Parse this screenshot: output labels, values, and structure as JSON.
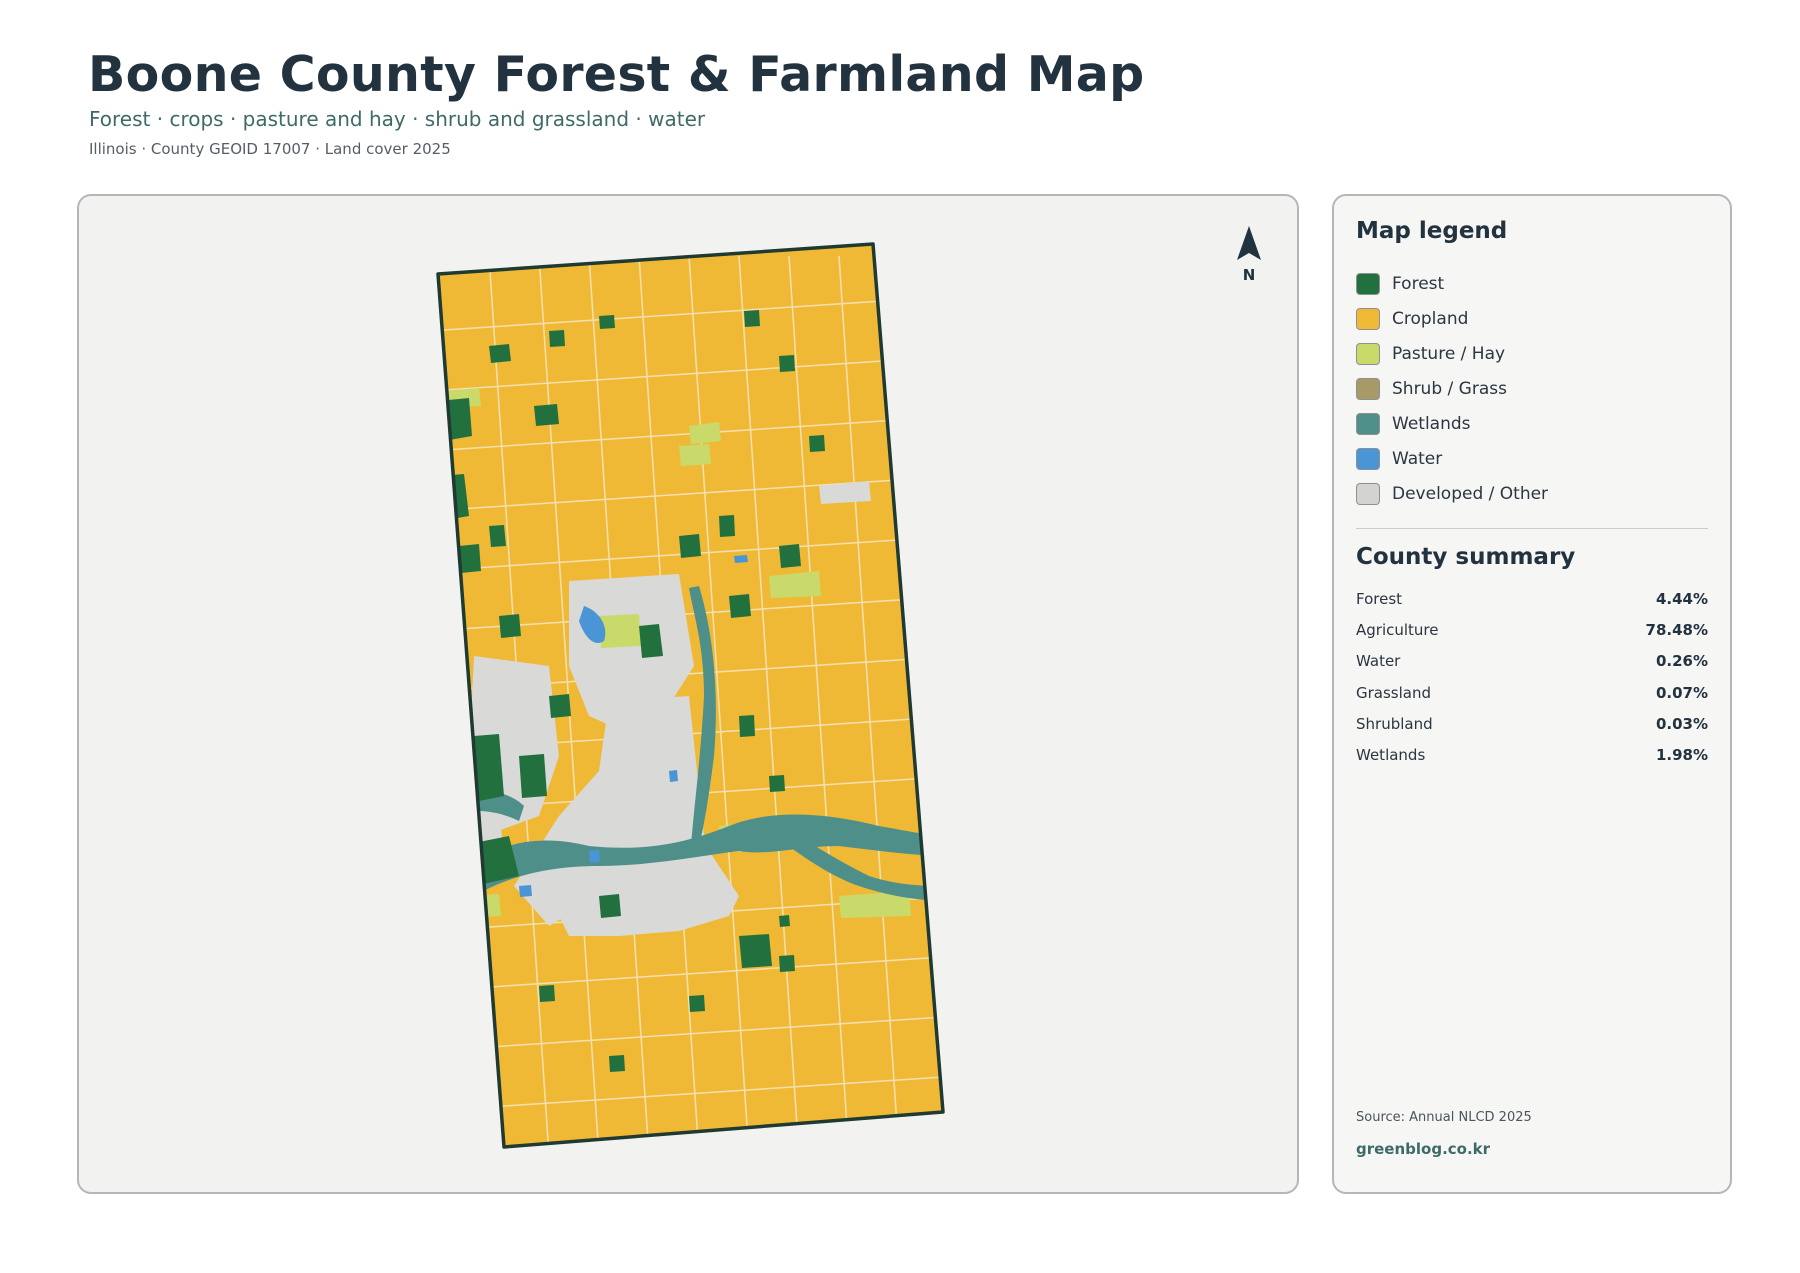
{
  "header": {
    "title": "Boone County Forest & Farmland Map",
    "subtitle": "Forest · crops · pasture and hay · shrub and grassland · water",
    "meta": "Illinois · County GEOID 17007 · Land cover 2025"
  },
  "map": {
    "north_label": "N",
    "colors": {
      "forest": "#23703f",
      "cropland": "#f0b935",
      "pasture": "#c9da6a",
      "shrub": "#a89a67",
      "wetlands": "#4e8f8a",
      "water": "#4a95d6",
      "developed": "#d9d9d7",
      "boundary": "#1f3a33",
      "background": "#f2f2f0"
    }
  },
  "legend": {
    "title": "Map legend",
    "items": [
      {
        "label": "Forest",
        "color": "#23703f"
      },
      {
        "label": "Cropland",
        "color": "#f0b935"
      },
      {
        "label": "Pasture / Hay",
        "color": "#c9da6a"
      },
      {
        "label": "Shrub / Grass",
        "color": "#a89a67"
      },
      {
        "label": "Wetlands",
        "color": "#4e8f8a"
      },
      {
        "label": "Water",
        "color": "#4a95d6"
      },
      {
        "label": "Developed / Other",
        "color": "#d3d3d1"
      }
    ]
  },
  "summary": {
    "title": "County summary",
    "rows": [
      {
        "name": "Forest",
        "value": "4.44%"
      },
      {
        "name": "Agriculture",
        "value": "78.48%"
      },
      {
        "name": "Water",
        "value": "0.26%"
      },
      {
        "name": "Grassland",
        "value": "0.07%"
      },
      {
        "name": "Shrubland",
        "value": "0.03%"
      },
      {
        "name": "Wetlands",
        "value": "1.98%"
      }
    ]
  },
  "footer": {
    "source": "Source: Annual NLCD 2025",
    "credit": "greenblog.co.kr"
  }
}
